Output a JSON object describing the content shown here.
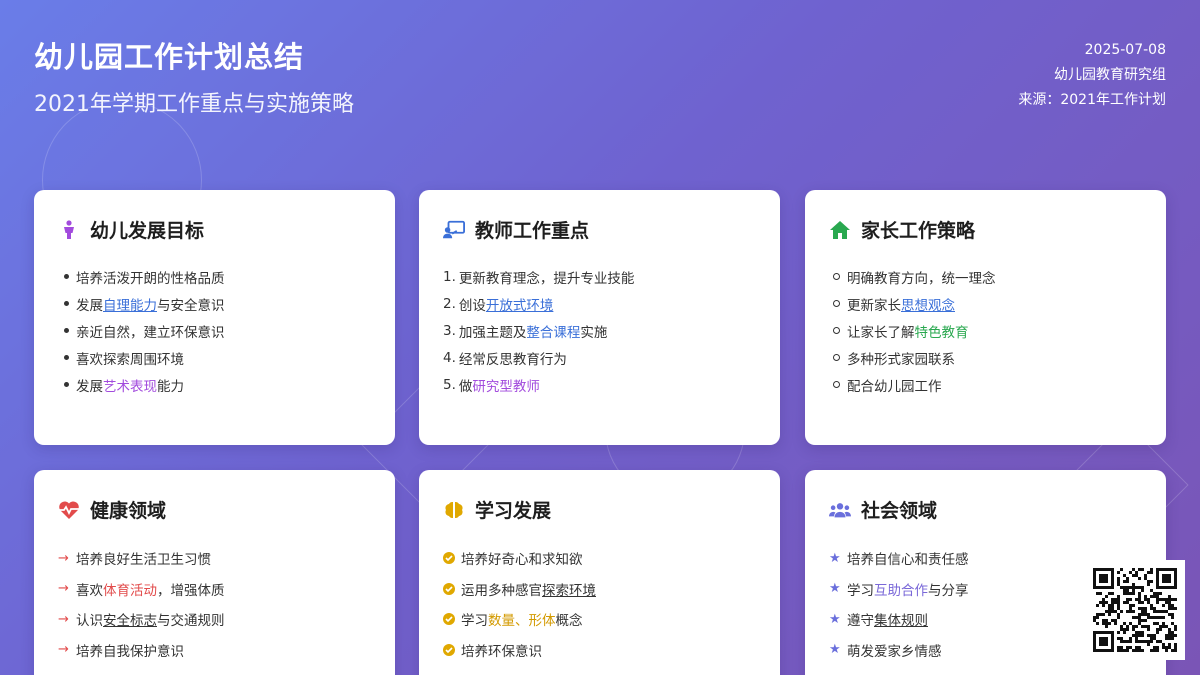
{
  "header": {
    "title": "幼儿园工作计划总结",
    "subtitle": "2021年学期工作重点与实施策略"
  },
  "meta": {
    "date": "2025-07-08",
    "org": "幼儿园教育研究组",
    "source": "来源：2021年工作计划"
  },
  "cards": [
    {
      "title": "幼儿发展目标",
      "icon": "child-icon",
      "items": [
        {
          "parts": [
            "培养活泼开朗的性格品质"
          ]
        },
        {
          "parts": [
            "发展",
            "自理能力",
            "与安全意识"
          ]
        },
        {
          "parts": [
            "亲近自然，建立环保意识"
          ]
        },
        {
          "parts": [
            "喜欢探索周围环境"
          ]
        },
        {
          "parts": [
            "发展",
            "艺术表现",
            "能力"
          ]
        }
      ]
    },
    {
      "title": "教师工作重点",
      "icon": "teacher-board-icon",
      "items": [
        {
          "num": "1.",
          "parts": [
            "更新教育理念，提升专业技能"
          ]
        },
        {
          "num": "2.",
          "parts": [
            "创设",
            "开放式环境"
          ]
        },
        {
          "num": "3.",
          "parts": [
            "加强主题及",
            "整合课程",
            "实施"
          ]
        },
        {
          "num": "4.",
          "parts": [
            "经常反思教育行为"
          ]
        },
        {
          "num": "5.",
          "parts": [
            "做",
            "研究型教师"
          ]
        }
      ]
    },
    {
      "title": "家长工作策略",
      "icon": "home-icon",
      "items": [
        {
          "parts": [
            "明确教育方向，统一理念"
          ]
        },
        {
          "parts": [
            "更新家长",
            "思想观念"
          ]
        },
        {
          "parts": [
            "让家长了解",
            "特色教育"
          ]
        },
        {
          "parts": [
            "多种形式家园联系"
          ]
        },
        {
          "parts": [
            "配合幼儿园工作"
          ]
        }
      ]
    },
    {
      "title": "健康领域",
      "icon": "heartbeat-icon",
      "items": [
        {
          "parts": [
            "培养良好生活卫生习惯"
          ]
        },
        {
          "parts": [
            "喜欢",
            "体育活动",
            "，增强体质"
          ]
        },
        {
          "parts": [
            "认识",
            "安全标志",
            "与交通规则"
          ]
        },
        {
          "parts": [
            "培养自我保护意识"
          ]
        }
      ]
    },
    {
      "title": "学习发展",
      "icon": "brain-icon",
      "items": [
        {
          "parts": [
            "培养好奇心和求知欲"
          ]
        },
        {
          "parts": [
            "运用多种感官",
            "探索环境"
          ]
        },
        {
          "parts": [
            "学习",
            "数量、形体",
            "概念"
          ]
        },
        {
          "parts": [
            "培养环保意识"
          ]
        }
      ]
    },
    {
      "title": "社会领域",
      "icon": "users-icon",
      "items": [
        {
          "parts": [
            "培养自信心和责任感"
          ]
        },
        {
          "parts": [
            "学习",
            "互助合作",
            "与分享"
          ]
        },
        {
          "parts": [
            "遵守",
            "集体规则"
          ]
        },
        {
          "parts": [
            "萌发爱家乡情感"
          ]
        }
      ]
    }
  ],
  "colors": {
    "background_start": "#6a7de8",
    "background_end": "#7a55b6",
    "blue": "#3a6fd8",
    "purple": "#a24bdd",
    "green": "#29a84f",
    "red": "#e24b4b",
    "yellow": "#d39a00"
  }
}
